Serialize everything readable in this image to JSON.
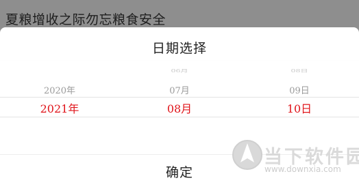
{
  "background": {
    "header_title": "夏粮增收之际勿忘粮食安全"
  },
  "picker": {
    "title": "日期选择",
    "columns": [
      {
        "name": "year",
        "items": [
          {
            "label": "2020年",
            "state": "near"
          },
          {
            "label": "2021年",
            "state": "selected"
          }
        ]
      },
      {
        "name": "month",
        "items": [
          {
            "label": "06月",
            "state": "far"
          },
          {
            "label": "07月",
            "state": "near"
          },
          {
            "label": "08月",
            "state": "selected"
          }
        ]
      },
      {
        "name": "day",
        "items": [
          {
            "label": "08日",
            "state": "far"
          },
          {
            "label": "09日",
            "state": "near"
          },
          {
            "label": "10日",
            "state": "selected"
          }
        ]
      }
    ],
    "selected": {
      "year": "2021年",
      "month": "08月",
      "day": "10日"
    },
    "confirm_label": "确定"
  },
  "watermark": {
    "name": "当下软件园",
    "url": "www.downxia.com"
  },
  "colors": {
    "selected_text": "#e0141a",
    "header_bg": "#8e8e8e"
  }
}
